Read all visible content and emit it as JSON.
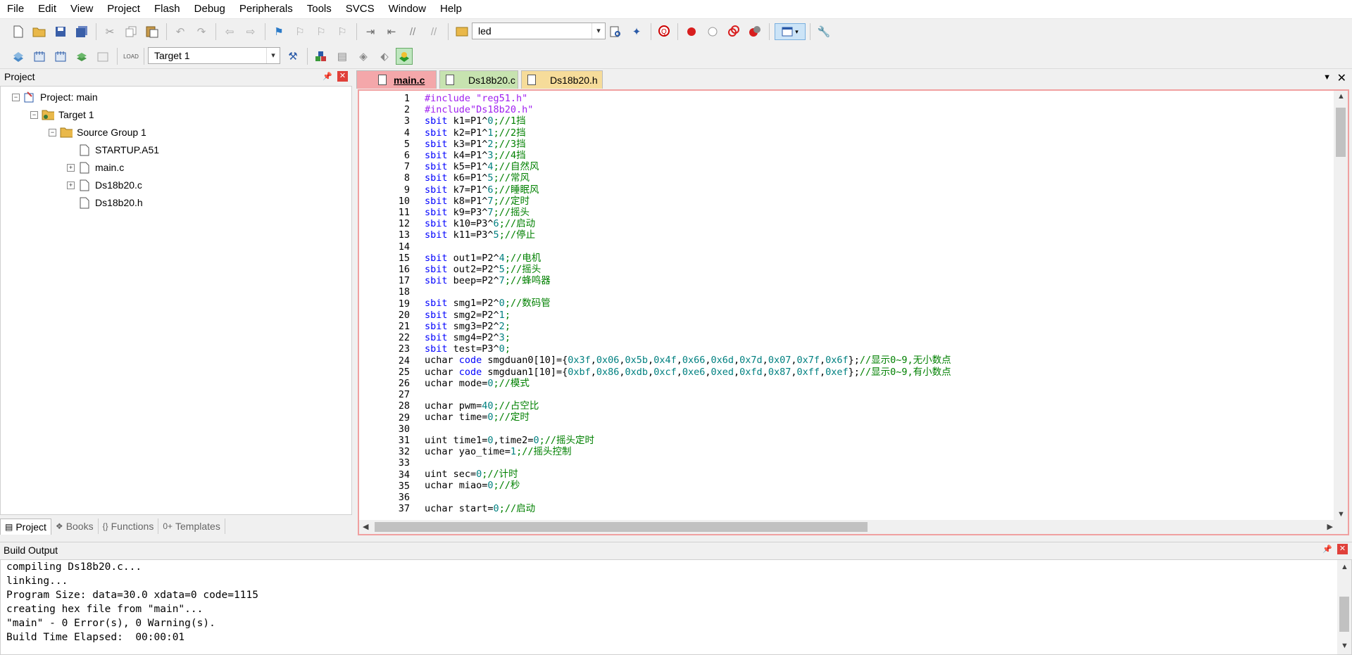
{
  "menu": [
    "File",
    "Edit",
    "View",
    "Project",
    "Flash",
    "Debug",
    "Peripherals",
    "Tools",
    "SVCS",
    "Window",
    "Help"
  ],
  "toolbar": {
    "icons": [
      "new-file-icon",
      "open-file-icon",
      "save-icon",
      "save-all-icon",
      "cut-icon",
      "copy-icon",
      "paste-icon",
      "undo-icon",
      "redo-icon",
      "nav-back-icon",
      "nav-forward-icon",
      "bookmark-icon",
      "prev-bookmark-icon",
      "next-bookmark-icon",
      "clear-bookmarks-icon",
      "indent-icon",
      "unindent-icon",
      "comment-icon",
      "uncomment-icon"
    ],
    "find_value": "led",
    "icons_right": [
      "find-in-files-icon",
      "configure-icon",
      "debug-start-icon",
      "breakpoint-icon",
      "breakpoint-disable-icon",
      "breakpoint-kill-icon",
      "breakpoint-clear-icon",
      "windows-layout-icon",
      "settings-wrench-icon"
    ]
  },
  "toolbar2": {
    "icons_left": [
      "translate-icon",
      "build-icon",
      "rebuild-icon",
      "batch-build-icon",
      "stop-build-icon",
      "download-icon"
    ],
    "target_value": "Target 1",
    "icons_right": [
      "target-options-icon",
      "manage-components-icon",
      "file-extensions-icon",
      "pack-installer-icon",
      "select-device-icon",
      "run-time-env-icon"
    ]
  },
  "project_panel": {
    "title": "Project",
    "tree": [
      {
        "label": "Project: main",
        "level": 0,
        "expander": "-",
        "icon": "project-icon"
      },
      {
        "label": "Target 1",
        "level": 1,
        "expander": "-",
        "icon": "target-icon"
      },
      {
        "label": "Source Group 1",
        "level": 2,
        "expander": "-",
        "icon": "folder-icon"
      },
      {
        "label": "STARTUP.A51",
        "level": 3,
        "expander": "",
        "icon": "file-icon"
      },
      {
        "label": "main.c",
        "level": 3,
        "expander": "+",
        "icon": "file-icon"
      },
      {
        "label": "Ds18b20.c",
        "level": 3,
        "expander": "+",
        "icon": "file-icon"
      },
      {
        "label": "Ds18b20.h",
        "level": 3,
        "expander": "",
        "icon": "file-icon"
      }
    ],
    "bottom_tabs": [
      {
        "label": "Project",
        "icon": "project-tab-icon"
      },
      {
        "label": "Books",
        "icon": "books-icon"
      },
      {
        "label": "Functions",
        "icon": "functions-icon"
      },
      {
        "label": "Templates",
        "icon": "templates-icon"
      }
    ]
  },
  "editor": {
    "tabs": [
      "main.c",
      "Ds18b20.c",
      "Ds18b20.h"
    ],
    "active_tab": "main.c",
    "lines": [
      [
        {
          "t": "#include ",
          "c": "pp"
        },
        {
          "t": "\"reg51.h\"",
          "c": "str"
        }
      ],
      [
        {
          "t": "#include",
          "c": "pp"
        },
        {
          "t": "\"Ds18b20.h\"",
          "c": "str"
        }
      ],
      [
        {
          "t": "sbit",
          "c": "kw"
        },
        {
          "t": " k1=P1^"
        },
        {
          "t": "0",
          "c": "num"
        },
        {
          "t": ";//1挡",
          "c": "cm"
        }
      ],
      [
        {
          "t": "sbit",
          "c": "kw"
        },
        {
          "t": " k2=P1^"
        },
        {
          "t": "1",
          "c": "num"
        },
        {
          "t": ";//2挡",
          "c": "cm"
        }
      ],
      [
        {
          "t": "sbit",
          "c": "kw"
        },
        {
          "t": " k3=P1^"
        },
        {
          "t": "2",
          "c": "num"
        },
        {
          "t": ";//3挡",
          "c": "cm"
        }
      ],
      [
        {
          "t": "sbit",
          "c": "kw"
        },
        {
          "t": " k4=P1^"
        },
        {
          "t": "3",
          "c": "num"
        },
        {
          "t": ";//4挡",
          "c": "cm"
        }
      ],
      [
        {
          "t": "sbit",
          "c": "kw"
        },
        {
          "t": " k5=P1^"
        },
        {
          "t": "4",
          "c": "num"
        },
        {
          "t": ";//自然风",
          "c": "cm"
        }
      ],
      [
        {
          "t": "sbit",
          "c": "kw"
        },
        {
          "t": " k6=P1^"
        },
        {
          "t": "5",
          "c": "num"
        },
        {
          "t": ";//常风",
          "c": "cm"
        }
      ],
      [
        {
          "t": "sbit",
          "c": "kw"
        },
        {
          "t": " k7=P1^"
        },
        {
          "t": "6",
          "c": "num"
        },
        {
          "t": ";//睡眠风",
          "c": "cm"
        }
      ],
      [
        {
          "t": "sbit",
          "c": "kw"
        },
        {
          "t": " k8=P1^"
        },
        {
          "t": "7",
          "c": "num"
        },
        {
          "t": ";//定时",
          "c": "cm"
        }
      ],
      [
        {
          "t": "sbit",
          "c": "kw"
        },
        {
          "t": " k9=P3^"
        },
        {
          "t": "7",
          "c": "num"
        },
        {
          "t": ";//摇头",
          "c": "cm"
        }
      ],
      [
        {
          "t": "sbit",
          "c": "kw"
        },
        {
          "t": " k10=P3^"
        },
        {
          "t": "6",
          "c": "num"
        },
        {
          "t": ";//启动",
          "c": "cm"
        }
      ],
      [
        {
          "t": "sbit",
          "c": "kw"
        },
        {
          "t": " k11=P3^"
        },
        {
          "t": "5",
          "c": "num"
        },
        {
          "t": ";//停止",
          "c": "cm"
        }
      ],
      [],
      [
        {
          "t": "sbit",
          "c": "kw"
        },
        {
          "t": " out1=P2^"
        },
        {
          "t": "4",
          "c": "num"
        },
        {
          "t": ";//电机",
          "c": "cm"
        }
      ],
      [
        {
          "t": "sbit",
          "c": "kw"
        },
        {
          "t": " out2=P2^"
        },
        {
          "t": "5",
          "c": "num"
        },
        {
          "t": ";//摇头",
          "c": "cm"
        }
      ],
      [
        {
          "t": "sbit",
          "c": "kw"
        },
        {
          "t": " beep=P2^"
        },
        {
          "t": "7",
          "c": "num"
        },
        {
          "t": ";//蜂鸣器",
          "c": "cm"
        }
      ],
      [],
      [
        {
          "t": "sbit",
          "c": "kw"
        },
        {
          "t": " smg1=P2^"
        },
        {
          "t": "0",
          "c": "num"
        },
        {
          "t": ";//数码管",
          "c": "cm"
        }
      ],
      [
        {
          "t": "sbit",
          "c": "kw"
        },
        {
          "t": " smg2=P2^"
        },
        {
          "t": "1",
          "c": "num"
        },
        {
          "t": ";",
          "c": "cm"
        }
      ],
      [
        {
          "t": "sbit",
          "c": "kw"
        },
        {
          "t": " smg3=P2^"
        },
        {
          "t": "2",
          "c": "num"
        },
        {
          "t": ";",
          "c": "cm"
        }
      ],
      [
        {
          "t": "sbit",
          "c": "kw"
        },
        {
          "t": " smg4=P2^"
        },
        {
          "t": "3",
          "c": "num"
        },
        {
          "t": ";",
          "c": "cm"
        }
      ],
      [
        {
          "t": "sbit",
          "c": "kw"
        },
        {
          "t": " test=P3^"
        },
        {
          "t": "0",
          "c": "num"
        },
        {
          "t": ";",
          "c": "cm"
        }
      ],
      [
        {
          "t": "uchar "
        },
        {
          "t": "code",
          "c": "kw"
        },
        {
          "t": " smgduan0[10]={"
        },
        {
          "t": "0x3f",
          "c": "num"
        },
        {
          "t": ","
        },
        {
          "t": "0x06",
          "c": "num"
        },
        {
          "t": ","
        },
        {
          "t": "0x5b",
          "c": "num"
        },
        {
          "t": ","
        },
        {
          "t": "0x4f",
          "c": "num"
        },
        {
          "t": ","
        },
        {
          "t": "0x66",
          "c": "num"
        },
        {
          "t": ","
        },
        {
          "t": "0x6d",
          "c": "num"
        },
        {
          "t": ","
        },
        {
          "t": "0x7d",
          "c": "num"
        },
        {
          "t": ","
        },
        {
          "t": "0x07",
          "c": "num"
        },
        {
          "t": ","
        },
        {
          "t": "0x7f",
          "c": "num"
        },
        {
          "t": ","
        },
        {
          "t": "0x6f",
          "c": "num"
        },
        {
          "t": "};"
        },
        {
          "t": "//显示0~9,无小数点",
          "c": "cm"
        }
      ],
      [
        {
          "t": "uchar "
        },
        {
          "t": "code",
          "c": "kw"
        },
        {
          "t": " smgduan1[10]={"
        },
        {
          "t": "0xbf",
          "c": "num"
        },
        {
          "t": ","
        },
        {
          "t": "0x86",
          "c": "num"
        },
        {
          "t": ","
        },
        {
          "t": "0xdb",
          "c": "num"
        },
        {
          "t": ","
        },
        {
          "t": "0xcf",
          "c": "num"
        },
        {
          "t": ","
        },
        {
          "t": "0xe6",
          "c": "num"
        },
        {
          "t": ","
        },
        {
          "t": "0xed",
          "c": "num"
        },
        {
          "t": ","
        },
        {
          "t": "0xfd",
          "c": "num"
        },
        {
          "t": ","
        },
        {
          "t": "0x87",
          "c": "num"
        },
        {
          "t": ","
        },
        {
          "t": "0xff",
          "c": "num"
        },
        {
          "t": ","
        },
        {
          "t": "0xef",
          "c": "num"
        },
        {
          "t": "};"
        },
        {
          "t": "//显示0~9,有小数点",
          "c": "cm"
        }
      ],
      [
        {
          "t": "uchar mode="
        },
        {
          "t": "0",
          "c": "num"
        },
        {
          "t": ";//模式",
          "c": "cm"
        }
      ],
      [],
      [
        {
          "t": "uchar pwm="
        },
        {
          "t": "40",
          "c": "num"
        },
        {
          "t": ";//占空比",
          "c": "cm"
        }
      ],
      [
        {
          "t": "uchar time="
        },
        {
          "t": "0",
          "c": "num"
        },
        {
          "t": ";//定时",
          "c": "cm"
        }
      ],
      [],
      [
        {
          "t": "uint time1="
        },
        {
          "t": "0",
          "c": "num"
        },
        {
          "t": ",time2="
        },
        {
          "t": "0",
          "c": "num"
        },
        {
          "t": ";//摇头定时",
          "c": "cm"
        }
      ],
      [
        {
          "t": "uchar yao_time="
        },
        {
          "t": "1",
          "c": "num"
        },
        {
          "t": ";//摇头控制",
          "c": "cm"
        }
      ],
      [],
      [
        {
          "t": "uint sec="
        },
        {
          "t": "0",
          "c": "num"
        },
        {
          "t": ";//计时",
          "c": "cm"
        }
      ],
      [
        {
          "t": "uchar miao="
        },
        {
          "t": "0",
          "c": "num"
        },
        {
          "t": ";//秒",
          "c": "cm"
        }
      ],
      [],
      [
        {
          "t": "uchar start="
        },
        {
          "t": "0",
          "c": "num"
        },
        {
          "t": ";//启动",
          "c": "cm"
        }
      ]
    ]
  },
  "build_output": {
    "title": "Build Output",
    "lines": [
      "compiling Ds18b20.c...",
      "linking...",
      "Program Size: data=30.0 xdata=0 code=1115",
      "creating hex file from \"main\"...",
      "\"main\" - 0 Error(s), 0 Warning(s).",
      "Build Time Elapsed:  00:00:01"
    ]
  },
  "colors": {
    "keyword": "#0000ff",
    "comment": "#008000",
    "number": "#008080",
    "preprocessor": "#a020f0"
  }
}
